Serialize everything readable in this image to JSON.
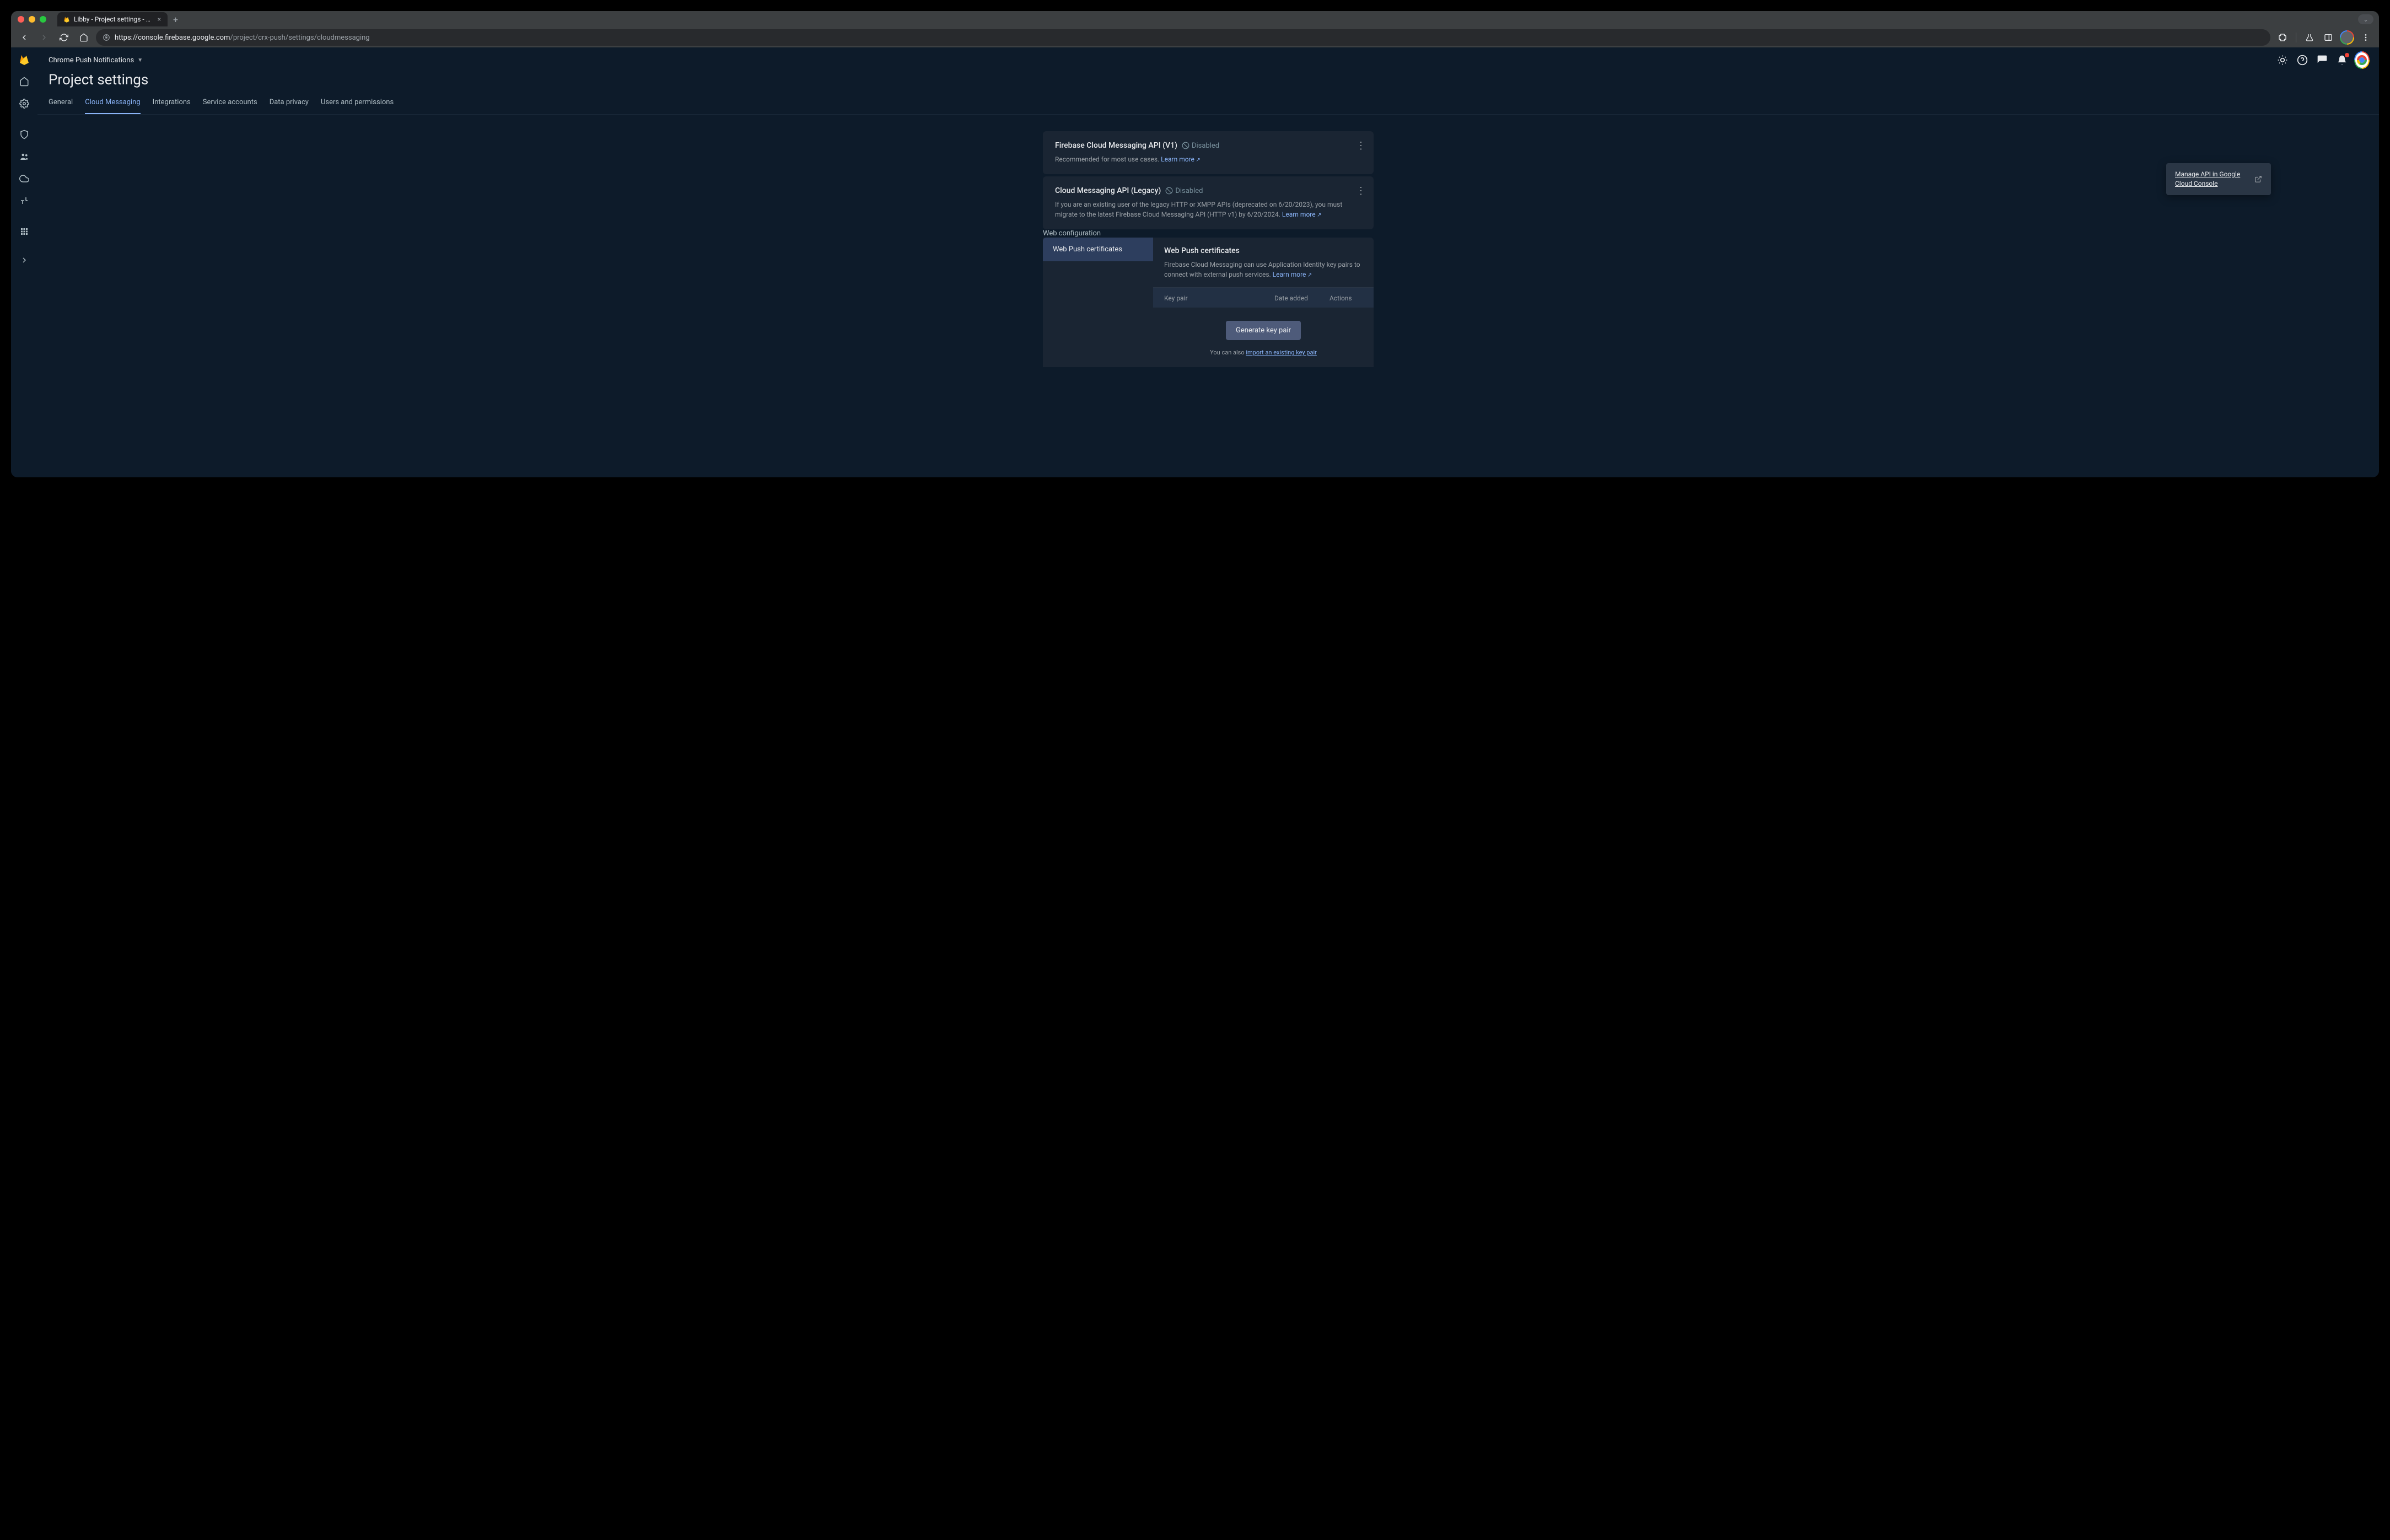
{
  "browser": {
    "tab_title": "Libby - Project settings - Fire",
    "url_domain": "https://console.firebase.google.com",
    "url_path": "/project/crx-push/settings/cloudmessaging"
  },
  "project": {
    "selector_label": "Chrome Push Notifications"
  },
  "page": {
    "title": "Project settings"
  },
  "tabs": {
    "general": "General",
    "cloud_messaging": "Cloud Messaging",
    "integrations": "Integrations",
    "service_accounts": "Service accounts",
    "data_privacy": "Data privacy",
    "users_permissions": "Users and permissions"
  },
  "card_v1": {
    "title": "Firebase Cloud Messaging API (V1)",
    "status": "Disabled",
    "desc": "Recommended for most use cases.",
    "learn": "Learn more"
  },
  "card_legacy": {
    "title": "Cloud Messaging API (Legacy)",
    "status": "Disabled",
    "desc": "If you are an existing user of the legacy HTTP or XMPP APIs (deprecated on 6/20/2023), you must migrate to the latest Firebase Cloud Messaging API (HTTP v1) by 6/20/2024.",
    "learn": "Learn more"
  },
  "popup": {
    "text": "Manage API in Google Cloud Console"
  },
  "web_config": {
    "heading": "Web configuration",
    "sidebar_item": "Web Push certificates",
    "title": "Web Push certificates",
    "desc": "Firebase Cloud Messaging can use Application Identity key pairs to connect with external push services.",
    "learn": "Learn more",
    "th_keypair": "Key pair",
    "th_date": "Date added",
    "th_actions": "Actions",
    "gen_button": "Generate key pair",
    "import_prefix": "You can also ",
    "import_link": "import an existing key pair"
  }
}
